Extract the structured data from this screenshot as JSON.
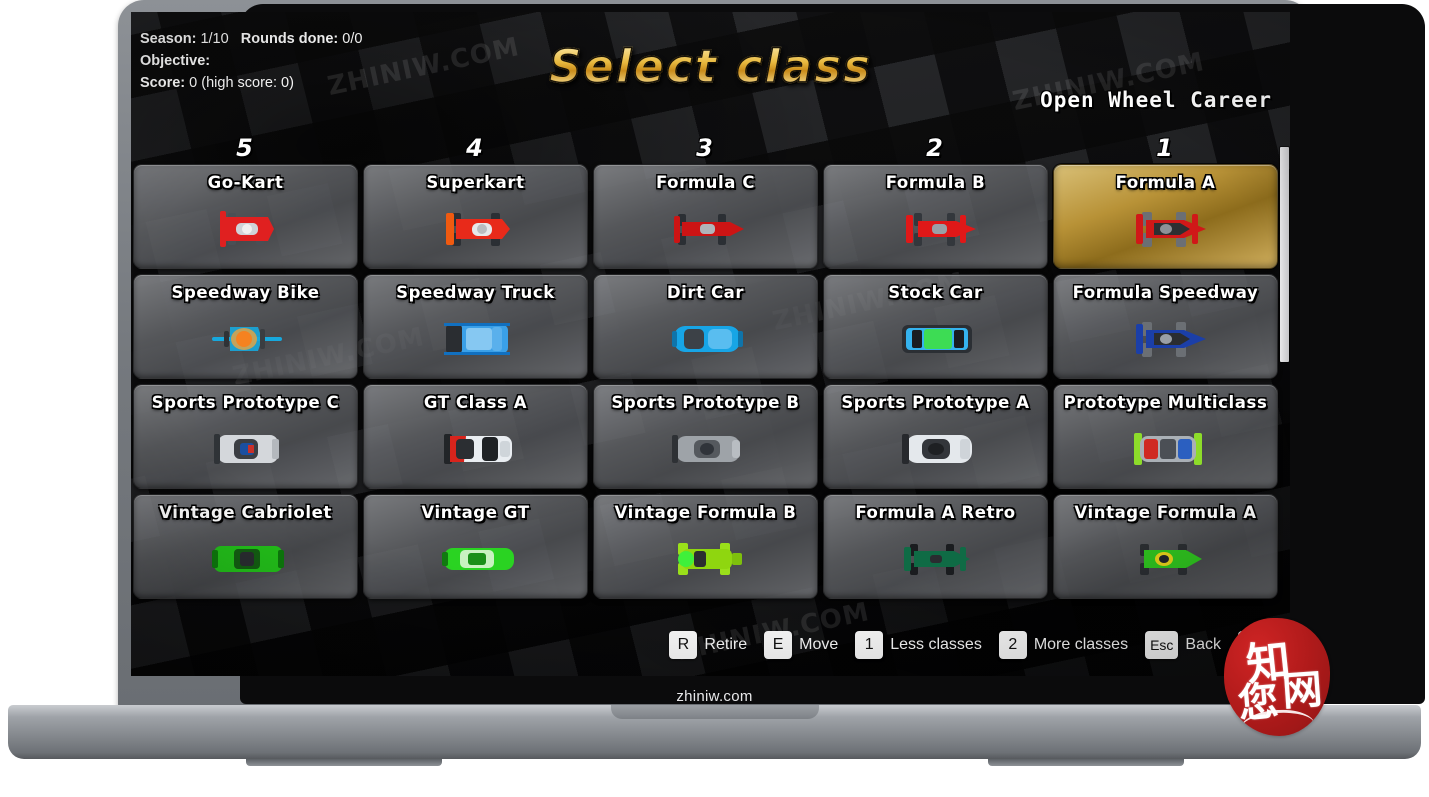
{
  "browser_bezel_label": "zhiniw.com",
  "hud": {
    "season_label": "Season:",
    "season_value": "1/10",
    "rounds_label": "Rounds done:",
    "rounds_value": "0/0",
    "objective_label": "Objective:",
    "objective_value": "",
    "score_label": "Score:",
    "score_value": "0 (high score: 0)"
  },
  "title": "Select class",
  "career_mode": "Open Wheel Career",
  "column_numbers": [
    "5",
    "4",
    "3",
    "2",
    "1"
  ],
  "grid": {
    "rows": [
      {
        "cards": [
          {
            "name": "Go-Kart",
            "sprite": "kart-red-icon",
            "selected": false
          },
          {
            "name": "Superkart",
            "sprite": "superkart-red-icon",
            "selected": false
          },
          {
            "name": "Formula C",
            "sprite": "formula-c-red-icon",
            "selected": false
          },
          {
            "name": "Formula B",
            "sprite": "formula-b-red-icon",
            "selected": false
          },
          {
            "name": "Formula A",
            "sprite": "formula-a-red-icon",
            "selected": true
          }
        ]
      },
      {
        "cards": [
          {
            "name": "Speedway Bike",
            "sprite": "speedway-bike-blue-icon",
            "selected": false
          },
          {
            "name": "Speedway Truck",
            "sprite": "speedway-truck-blue-icon",
            "selected": false
          },
          {
            "name": "Dirt Car",
            "sprite": "dirt-car-blue-icon",
            "selected": false
          },
          {
            "name": "Stock Car",
            "sprite": "stock-car-blue-icon",
            "selected": false
          },
          {
            "name": "Formula Speedway",
            "sprite": "formula-speedway-blue-icon",
            "selected": false
          }
        ]
      },
      {
        "cards": [
          {
            "name": "Sports Prototype C",
            "sprite": "prototype-c-silver-icon",
            "selected": false
          },
          {
            "name": "GT Class A",
            "sprite": "gt-class-a-white-icon",
            "selected": false
          },
          {
            "name": "Sports Prototype B",
            "sprite": "prototype-b-silver-icon",
            "selected": false
          },
          {
            "name": "Sports Prototype A",
            "sprite": "prototype-a-white-icon",
            "selected": false
          },
          {
            "name": "Prototype Multiclass",
            "sprite": "prototype-multi-icon",
            "selected": false
          }
        ]
      },
      {
        "cards": [
          {
            "name": "Vintage Cabriolet",
            "sprite": "cabriolet-green-icon",
            "selected": false
          },
          {
            "name": "Vintage GT",
            "sprite": "vintage-gt-green-icon",
            "selected": false
          },
          {
            "name": "Vintage Formula B",
            "sprite": "vintage-fb-green-icon",
            "selected": false
          },
          {
            "name": "Formula A Retro",
            "sprite": "formula-a-retro-green-icon",
            "selected": false
          },
          {
            "name": "Vintage Formula A",
            "sprite": "vintage-fa-green-icon",
            "selected": false
          }
        ]
      }
    ]
  },
  "keyhints": [
    {
      "key": "R",
      "label": "Retire"
    },
    {
      "key": "E",
      "label": "Move"
    },
    {
      "key": "1",
      "label": "Less classes"
    },
    {
      "key": "2",
      "label": "More classes"
    },
    {
      "key": "Esc",
      "label": "Back"
    },
    {
      "key": "↵",
      "label": ""
    }
  ],
  "watermark_text": "ZHINIW.COM",
  "seal": {
    "glyph1": "知",
    "glyph2": "网",
    "glyph3": "您"
  },
  "colors": {
    "selected_card": "#b89237",
    "title_gold": "#e8b93f",
    "screen_bg": "#08080a",
    "seal_red": "#b21b1b"
  }
}
